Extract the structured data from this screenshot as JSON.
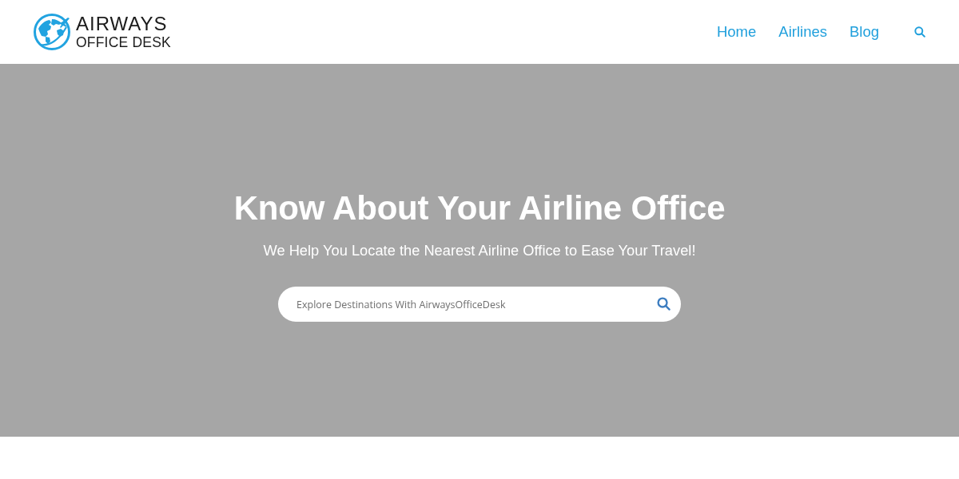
{
  "header": {
    "logo": {
      "lines": [
        "AIRWAYS",
        "OFFICE DESK"
      ]
    },
    "nav": [
      {
        "label": "Home"
      },
      {
        "label": "Airlines"
      },
      {
        "label": "Blog"
      }
    ]
  },
  "hero": {
    "title": "Know About Your Airline Office",
    "subtitle": "We Help You Locate the Nearest Airline Office to Ease Your Travel!",
    "search": {
      "placeholder": "Explore Destinations With AirwaysOfficeDesk"
    }
  }
}
